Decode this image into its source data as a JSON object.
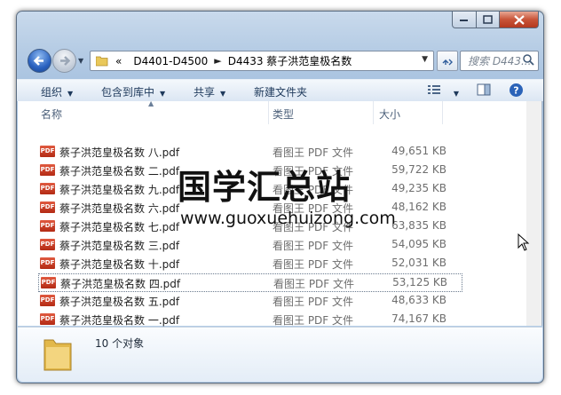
{
  "window": {
    "breadcrumb": {
      "overflow": "«",
      "crumbs": [
        "D4401-D4500",
        "D4433 蔡子洪范皇极名数"
      ]
    },
    "search_placeholder": "搜索 D443...",
    "toolbar": {
      "organize": "组织",
      "include_in_library": "包含到库中",
      "share": "共享",
      "new_folder": "新建文件夹"
    },
    "columns": {
      "name": "名称",
      "type": "类型",
      "size": "大小"
    },
    "files": [
      {
        "name": "蔡子洪范皇极名数 八.pdf",
        "type": "看图王 PDF 文件",
        "size": "49,651 KB"
      },
      {
        "name": "蔡子洪范皇极名数 二.pdf",
        "type": "看图王 PDF 文件",
        "size": "59,722 KB"
      },
      {
        "name": "蔡子洪范皇极名数 九.pdf",
        "type": "看图王 PDF 文件",
        "size": "49,235 KB"
      },
      {
        "name": "蔡子洪范皇极名数 六.pdf",
        "type": "看图王 PDF 文件",
        "size": "48,162 KB"
      },
      {
        "name": "蔡子洪范皇极名数 七.pdf",
        "type": "看图王 PDF 文件",
        "size": "63,835 KB"
      },
      {
        "name": "蔡子洪范皇极名数 三.pdf",
        "type": "看图王 PDF 文件",
        "size": "54,095 KB"
      },
      {
        "name": "蔡子洪范皇极名数 十.pdf",
        "type": "看图王 PDF 文件",
        "size": "52,031 KB"
      },
      {
        "name": "蔡子洪范皇极名数 四.pdf",
        "type": "看图王 PDF 文件",
        "size": "53,125 KB"
      },
      {
        "name": "蔡子洪范皇极名数 五.pdf",
        "type": "看图王 PDF 文件",
        "size": "48,633 KB"
      },
      {
        "name": "蔡子洪范皇极名数 一.pdf",
        "type": "看图王 PDF 文件",
        "size": "74,167 KB"
      }
    ],
    "file_icon_label": "PDF",
    "selected_index": 7,
    "status": "10 个对象"
  },
  "watermark": {
    "title": "国学汇总站",
    "url": "www.guoxuehuizong.com"
  },
  "colors": {
    "accent": "#2a62c0",
    "window_frame": "#b7cde5",
    "pdf_icon": "#c8391f"
  }
}
